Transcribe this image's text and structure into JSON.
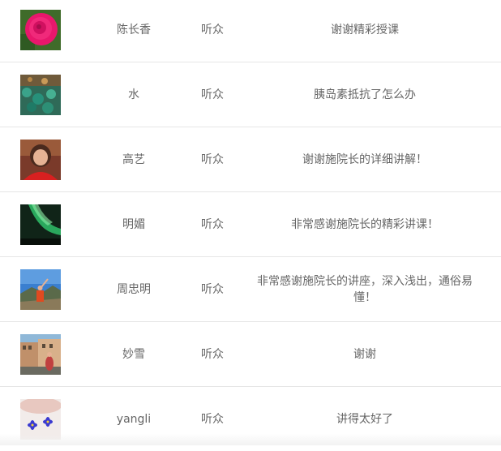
{
  "rows": [
    {
      "avatar": "rose-photo-avatar",
      "name": "陈长香",
      "role": "听众",
      "comment": "谢谢精彩授课"
    },
    {
      "avatar": "garden-photo-avatar",
      "name": "水",
      "role": "听众",
      "comment": "胰岛素抵抗了怎么办"
    },
    {
      "avatar": "woman-portrait-avatar",
      "name": "高艺",
      "role": "听众",
      "comment": "谢谢施院长的详细讲解！"
    },
    {
      "avatar": "aurora-photo-avatar",
      "name": "明媚",
      "role": "听众",
      "comment": "非常感谢施院长的精彩讲课！"
    },
    {
      "avatar": "mountain-hiker-avatar",
      "name": "周忠明",
      "role": "听众",
      "comment": "非常感谢施院长的讲座，深入浅出，通俗易懂！"
    },
    {
      "avatar": "city-street-avatar",
      "name": "妙雪",
      "role": "听众",
      "comment": "谢谢"
    },
    {
      "avatar": "flowers-plate-avatar",
      "name": "yangli",
      "role": "听众",
      "comment": "讲得太好了"
    }
  ]
}
